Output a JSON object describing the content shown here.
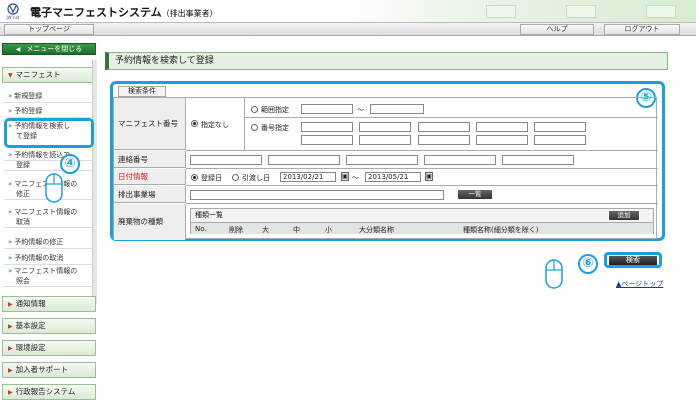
{
  "header": {
    "app_title": "電子マニフェストシステム",
    "app_subtitle": "（排出事業者）",
    "logo_caption": "JW net"
  },
  "navbar": {
    "top_page": "トップページ",
    "help": "ヘルプ",
    "logout": "ログアウト"
  },
  "sidebar": {
    "close_menu": "メニューを閉じる",
    "manifest_section": "マニフェスト",
    "items": [
      "新規登録",
      "予約登録",
      "予約情報を検索し",
      "て登録",
      "予約情報を読込で",
      "登録",
      "マニフェスト情報の",
      "修正",
      "マニフェスト情報の",
      "取消",
      "予約情報の修正",
      "予約情報の取消",
      "マニフェスト情報の",
      "照会"
    ],
    "sections": [
      "通知情報",
      "基本設定",
      "環境設定",
      "加入者サポート",
      "行政報告システム"
    ]
  },
  "main": {
    "page_title": "予約情報を検索して登録",
    "condition_tab": "検索条件",
    "manifest_number_label": "マニフェスト番号",
    "opt_none": "指定なし",
    "opt_range": "範囲指定",
    "opt_number": "番号指定",
    "range_sep": "〜",
    "contact_label": "連絡番号",
    "date_label": "日付情報",
    "opt_reg_date": "登録日",
    "opt_handover_date": "引渡し日",
    "date_from": "2013/02/21",
    "date_to": "2013/05/21",
    "cal_icon": "▣",
    "emitter_label": "排出事業場",
    "list_button": "一覧",
    "waste_label": "廃棄物の種類",
    "waste_list_title": "種類一覧",
    "add_button": "追加",
    "columns": [
      "No.",
      "削除",
      "大",
      "中",
      "小",
      "大分類名称",
      "種類名称(細分類を除く)"
    ],
    "search_button": "検索",
    "page_top": "▲ページトップ"
  },
  "callouts": {
    "step4": "④",
    "step5": "⑤",
    "step6": "⑥"
  },
  "colors": {
    "accent_green": "#2d7a36",
    "highlight_blue": "#1aa0e0",
    "date_label_red": "#d2201a"
  }
}
